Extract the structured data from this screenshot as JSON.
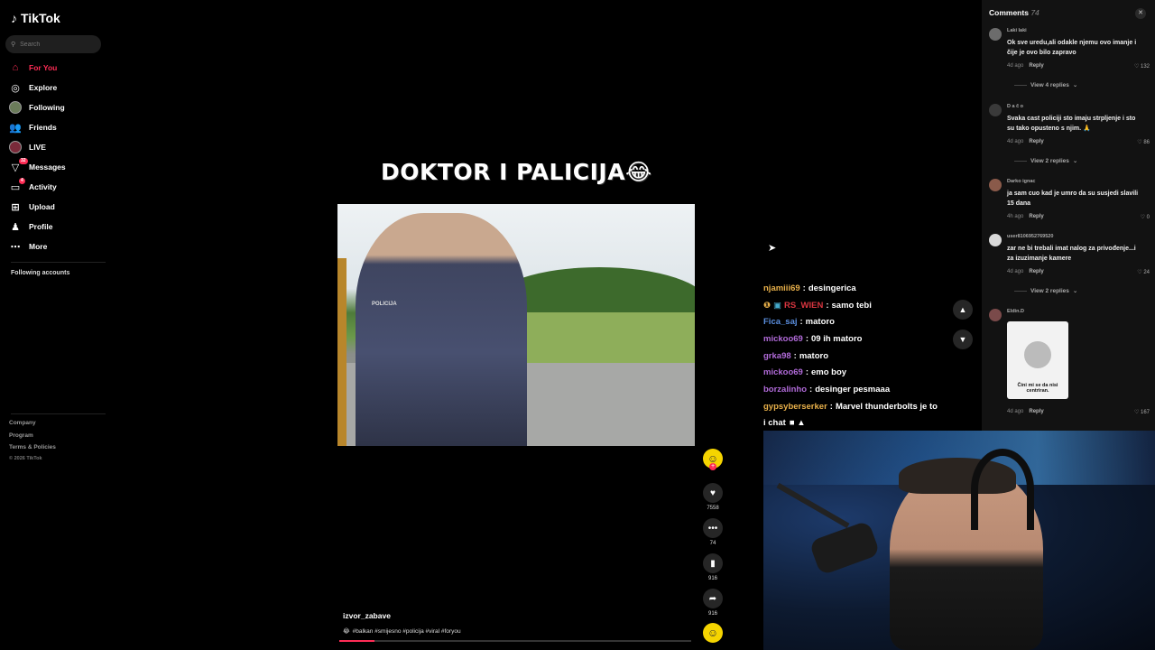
{
  "app": {
    "title": "TikTok"
  },
  "search": {
    "placeholder": "Search"
  },
  "nav": [
    {
      "label": "For You",
      "icon": "home-icon"
    },
    {
      "label": "Explore",
      "icon": "compass-icon"
    },
    {
      "label": "Following",
      "icon": "following-avatar-icon"
    },
    {
      "label": "Friends",
      "icon": "friends-icon"
    },
    {
      "label": "LIVE",
      "icon": "live-avatar-icon"
    },
    {
      "label": "Messages",
      "icon": "messages-icon",
      "badge": "32"
    },
    {
      "label": "Activity",
      "icon": "activity-icon",
      "badge": "4"
    },
    {
      "label": "Upload",
      "icon": "upload-icon"
    },
    {
      "label": "Profile",
      "icon": "profile-icon"
    },
    {
      "label": "More",
      "icon": "more-icon"
    }
  ],
  "following_accounts": "Following accounts",
  "footer": [
    "Company",
    "Program",
    "Terms & Policies",
    "© 2026 TikTok"
  ],
  "video": {
    "title": "DOKTOR I PALICIJA😂",
    "overlay_label": "POLICIJA",
    "creator": "izvor_zabave",
    "tags": "#balkan #smijesno #policija #viral #foryou",
    "progress": 0.1
  },
  "actions": {
    "likes": "7558",
    "comments": "74",
    "saves": "916",
    "shares": "916"
  },
  "chat": [
    {
      "user": "njamiii69",
      "msg": "desingerica",
      "color": "#e8b04a"
    },
    {
      "user": "RS_WIEN",
      "msg": "samo tebi",
      "color": "#d8353f",
      "badges": true
    },
    {
      "user": "Fica_saj",
      "msg": "matoro",
      "color": "#5b8fe0"
    },
    {
      "user": "mickoo69",
      "msg": "09 ih matoro",
      "color": "#b06ad8"
    },
    {
      "user": "grka98",
      "msg": "matoro",
      "color": "#b06ad8"
    },
    {
      "user": "mickoo69",
      "msg": "emo boy",
      "color": "#b06ad8"
    },
    {
      "user": "borzalinho",
      "msg": "desinger pesmaaa",
      "color": "#b06ad8"
    },
    {
      "user": "gypsyberserker",
      "msg": "Marvel thunderbolts je to",
      "color": "#e8b04a"
    },
    {
      "user": "",
      "msg": "i chat",
      "color": "#ffffff"
    }
  ],
  "comments_panel": {
    "title": "Comments",
    "count": "74",
    "items": [
      {
        "user": "Laki laki",
        "text": "Ok sve uredu,ali odakle njemu ovo imanje i čije je ovo bilo zapravo",
        "time": "4d ago",
        "reply": "Reply",
        "likes": "132",
        "view_replies": "View 4 replies"
      },
      {
        "user": "D a č o",
        "text": "Svaka cast policiji sto imaju strpljenje i sto su tako opusteno s njim. 🙏",
        "time": "4d ago",
        "reply": "Reply",
        "likes": "86",
        "view_replies": "View 2 replies"
      },
      {
        "user": "Darko ignac",
        "text": "ja sam cuo kad je umro da su susjedi slavili 15 dana",
        "time": "4h ago",
        "reply": "Reply",
        "likes": "0"
      },
      {
        "user": "user8106952769520",
        "text": "zar ne bi trebali imat nalog za privođenje...i za izuzimanje kamere",
        "time": "4d ago",
        "reply": "Reply",
        "likes": "24",
        "view_replies": "View 2 replies"
      },
      {
        "user": "Eldin.D",
        "sticker_text": "Čini mi se da nisi centriran.",
        "time": "4d ago",
        "reply": "Reply",
        "likes": "167"
      }
    ]
  }
}
